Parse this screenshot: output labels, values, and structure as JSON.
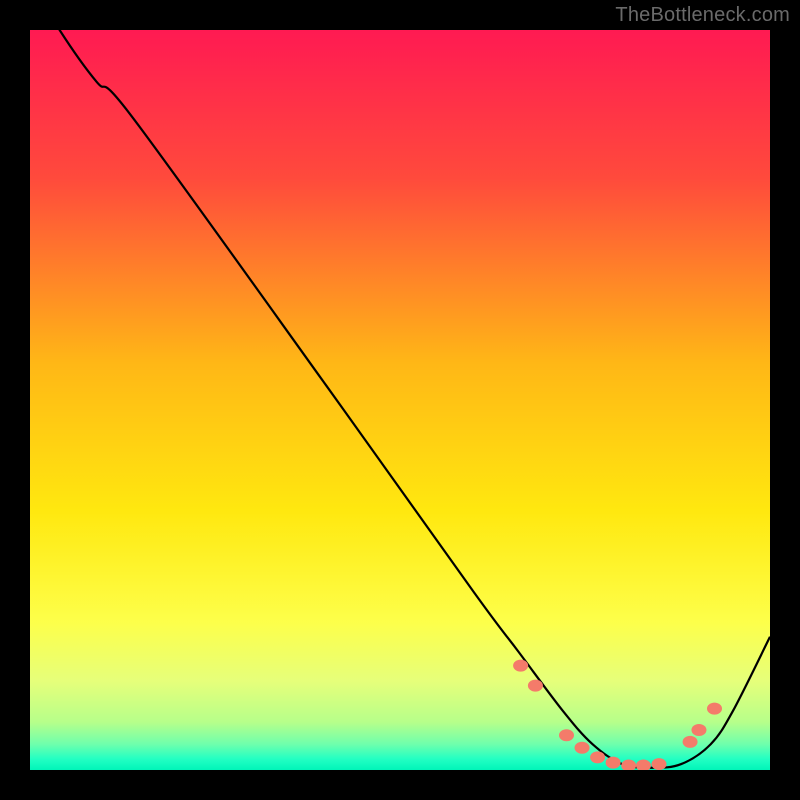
{
  "attribution": "TheBottleneck.com",
  "chart_data": {
    "type": "line",
    "title": "",
    "xlabel": "",
    "ylabel": "",
    "xlim": [
      0,
      100
    ],
    "ylim": [
      0,
      100
    ],
    "series": [
      {
        "name": "curve",
        "x": [
          0,
          4,
          9,
          14,
          40,
          60,
          66,
          72,
          76,
          80,
          84,
          88,
          92,
          95,
          100
        ],
        "y": [
          107,
          100,
          93,
          88,
          52,
          24,
          16,
          8,
          3.5,
          0.8,
          0.3,
          0.8,
          3.5,
          8,
          18
        ]
      }
    ],
    "markers": {
      "name": "highlight-dots",
      "color": "#f47b6a",
      "points_x": [
        66.3,
        68.3,
        72.5,
        74.6,
        76.7,
        78.8,
        80.9,
        82.9,
        85.0,
        89.2,
        90.4,
        92.5
      ],
      "points_y": [
        14.1,
        11.4,
        4.7,
        3.0,
        1.7,
        1.0,
        0.6,
        0.6,
        0.8,
        3.8,
        5.4,
        8.3
      ]
    },
    "background_gradient": {
      "stops": [
        {
          "offset": 0.0,
          "color": "#ff1a52"
        },
        {
          "offset": 0.2,
          "color": "#ff4a3c"
        },
        {
          "offset": 0.45,
          "color": "#ffb716"
        },
        {
          "offset": 0.65,
          "color": "#ffe80f"
        },
        {
          "offset": 0.8,
          "color": "#fdff4a"
        },
        {
          "offset": 0.88,
          "color": "#e6ff7a"
        },
        {
          "offset": 0.935,
          "color": "#b7ff8a"
        },
        {
          "offset": 0.965,
          "color": "#6fffac"
        },
        {
          "offset": 0.985,
          "color": "#23ffc3"
        },
        {
          "offset": 1.0,
          "color": "#00f5b9"
        }
      ]
    }
  }
}
